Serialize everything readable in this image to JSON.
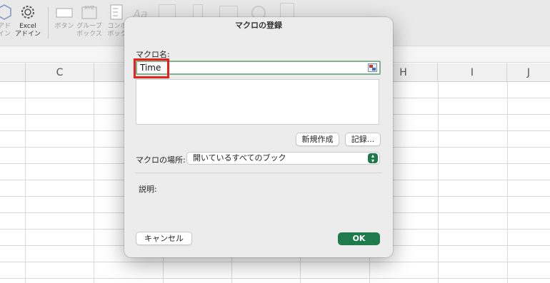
{
  "ribbon": {
    "items": [
      {
        "label": "アド\nイン",
        "icon": "hexagon-icon"
      },
      {
        "label": "Excel\nアドイン",
        "icon": "gear-icon"
      },
      {
        "label": "ボタン",
        "icon": "button-control-icon"
      },
      {
        "label": "グループ\nボックス",
        "icon": "group-box-icon"
      },
      {
        "label": "コンボ\nボック",
        "icon": "combo-box-icon"
      }
    ]
  },
  "columns": [
    "C",
    "H",
    "I",
    "J"
  ],
  "dialog": {
    "title": "マクロの登録",
    "name_label": "マクロ名:",
    "name_value": "Time",
    "new_button": "新規作成",
    "record_button": "記録...",
    "location_label": "マクロの場所:",
    "location_value": "開いているすべてのブック",
    "description_label": "説明:",
    "cancel_button": "キャンセル",
    "ok_button": "OK"
  },
  "colors": {
    "accent": "#1f7a4c",
    "highlight": "#e8211b"
  }
}
